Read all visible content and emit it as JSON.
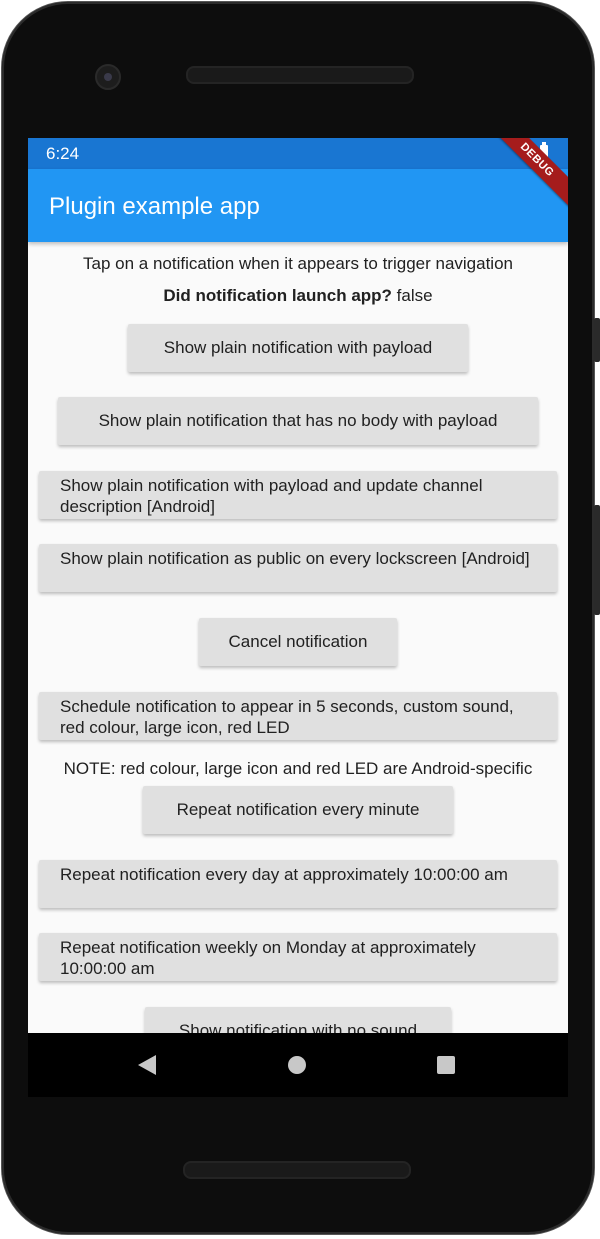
{
  "status_bar": {
    "time": "6:24"
  },
  "app_bar": {
    "title": "Plugin example app",
    "debug_label": "DEBUG"
  },
  "main": {
    "instruction": "Tap on a notification when it appears to trigger navigation",
    "launch_label": "Did notification launch app?",
    "launch_value": "false",
    "note": "NOTE: red colour, large icon and red LED are Android-specific",
    "buttons": [
      "Show plain notification with payload",
      "Show plain notification that has no body with payload",
      "Show plain notification with payload and update channel description [Android]",
      "Show plain notification as public on every lockscreen [Android]",
      "Cancel notification",
      "Schedule notification to appear in 5 seconds, custom sound, red colour, large icon, red LED",
      "Repeat notification every minute",
      "Repeat notification every day at approximately 10:00:00 am",
      "Repeat notification weekly on Monday at approximately 10:00:00 am",
      "Show notification with no sound"
    ]
  },
  "colors": {
    "status_bar": "#1976d2",
    "app_bar": "#2196f3",
    "button": "#e0e0e0",
    "background": "#fafafa",
    "debug_ribbon": "#a51c1c"
  },
  "icons": [
    "wifi-icon",
    "battery-icon",
    "back-icon",
    "home-icon",
    "recents-icon",
    "camera-icon"
  ]
}
